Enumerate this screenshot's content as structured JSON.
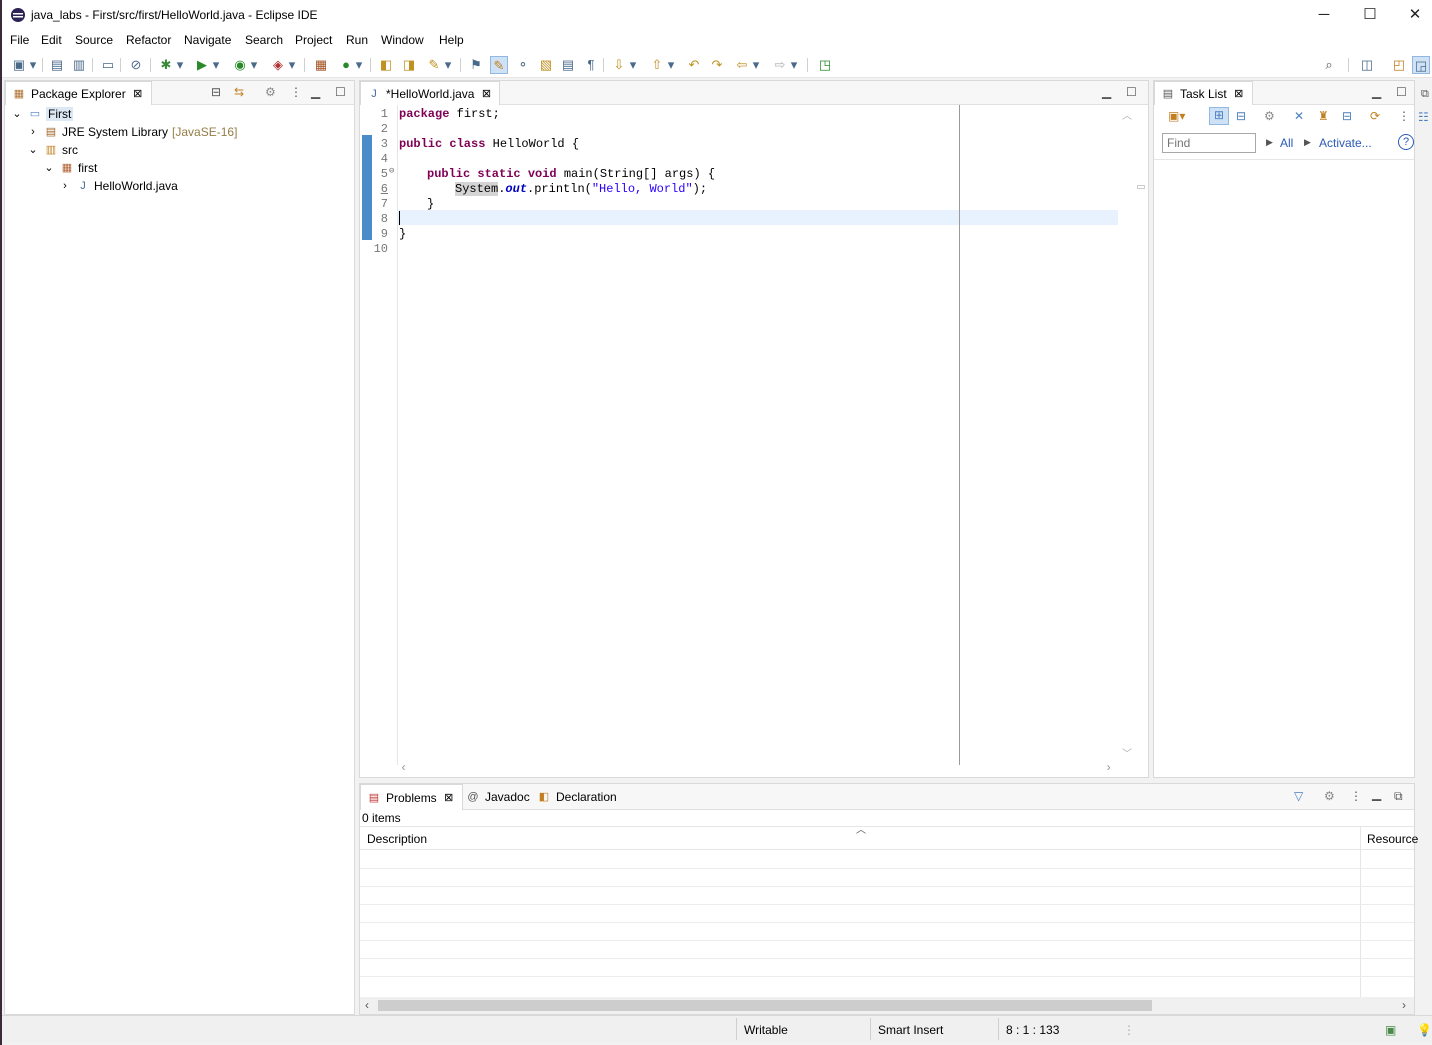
{
  "window": {
    "title": "java_labs - First/src/first/HelloWorld.java - Eclipse IDE",
    "minimize": "─",
    "maximize": "☐",
    "close": "✕"
  },
  "menu": [
    "File",
    "Edit",
    "Source",
    "Refactor",
    "Navigate",
    "Search",
    "Project",
    "Run",
    "Window",
    "Help"
  ],
  "package_explorer": {
    "tab": "Package Explorer",
    "tree": [
      {
        "label": "First",
        "extra": "",
        "level": 0,
        "icon": "project-icon"
      },
      {
        "label": "JRE System Library",
        "extra": "[JavaSE-16]",
        "level": 1,
        "icon": "library-icon"
      },
      {
        "label": "src",
        "extra": "",
        "level": 1,
        "icon": "source-folder-icon"
      },
      {
        "label": "first",
        "extra": "",
        "level": 2,
        "icon": "package-icon"
      },
      {
        "label": "HelloWorld.java",
        "extra": "",
        "level": 3,
        "icon": "java-file-icon"
      }
    ]
  },
  "editor": {
    "tab": "*HelloWorld.java",
    "lines": [
      "1",
      "2",
      "3",
      "4",
      "5",
      "6",
      "7",
      "8",
      "9",
      "10"
    ],
    "code": {
      "l1_kw": "package",
      "l1_rest": " first;",
      "l3_kw": "public class",
      "l3_rest": " HelloWorld {",
      "l5_kw": "public static void",
      "l5_rest": " main(String[] args) {",
      "l6_a": "System",
      "l6_b": ".",
      "l6_c": "out",
      "l6_d": ".println(",
      "l6_e": "\"Hello, World\"",
      "l6_f": ");",
      "l7": "}",
      "l9": "}"
    }
  },
  "task_list": {
    "tab": "Task List",
    "find_placeholder": "Find",
    "all": "All",
    "activate": "Activate..."
  },
  "bottom": {
    "tabs": [
      "Problems",
      "Javadoc",
      "Declaration"
    ],
    "count": "0 items",
    "columns": [
      "Description",
      "Resource"
    ]
  },
  "status": {
    "writable": "Writable",
    "insert": "Smart Insert",
    "position": "8 : 1 : 133"
  }
}
